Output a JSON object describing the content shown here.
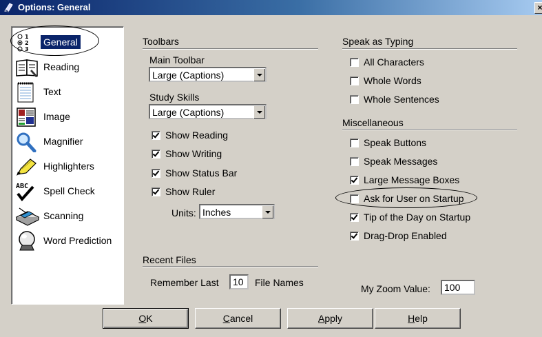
{
  "window": {
    "title": "Options: General",
    "close_label": "×"
  },
  "sidebar": {
    "items": [
      {
        "label": "General",
        "icon": "radio-list-icon",
        "selected": true
      },
      {
        "label": "Reading",
        "icon": "book-icon"
      },
      {
        "label": "Text",
        "icon": "notepad-icon"
      },
      {
        "label": "Image",
        "icon": "picture-icon"
      },
      {
        "label": "Magnifier",
        "icon": "magnifier-icon"
      },
      {
        "label": "Highlighters",
        "icon": "highlighter-icon"
      },
      {
        "label": "Spell Check",
        "icon": "spell-check-icon"
      },
      {
        "label": "Scanning",
        "icon": "scanner-icon"
      },
      {
        "label": "Word Prediction",
        "icon": "crystal-ball-icon"
      }
    ]
  },
  "toolbars": {
    "title": "Toolbars",
    "main_label": "Main Toolbar",
    "main_value": "Large (Captions)",
    "study_label": "Study Skills",
    "study_value": "Large (Captions)",
    "show_reading": "Show Reading",
    "show_writing": "Show Writing",
    "show_status_bar": "Show Status Bar",
    "show_ruler": "Show Ruler",
    "units_label": "Units:",
    "units_value": "Inches"
  },
  "recent_files": {
    "title": "Recent Files",
    "remember_label": "Remember Last",
    "remember_value": "10",
    "suffix": "File Names"
  },
  "speak_as_typing": {
    "title": "Speak as Typing",
    "all_characters": "All Characters",
    "whole_words": "Whole Words",
    "whole_sentences": "Whole Sentences"
  },
  "misc": {
    "title": "Miscellaneous",
    "speak_buttons": "Speak Buttons",
    "speak_messages": "Speak Messages",
    "large_message_boxes": "Large Message Boxes",
    "ask_for_user": "Ask for User on Startup",
    "tip_of_day": "Tip of the Day on Startup",
    "drag_drop": "Drag-Drop Enabled"
  },
  "zoom": {
    "label": "My Zoom Value:",
    "value": "100"
  },
  "buttons": {
    "ok_u": "O",
    "ok_rest": "K",
    "cancel_u": "C",
    "cancel_rest": "ancel",
    "apply_u": "A",
    "apply_rest": "pply",
    "help_u": "H",
    "help_rest": "elp"
  }
}
